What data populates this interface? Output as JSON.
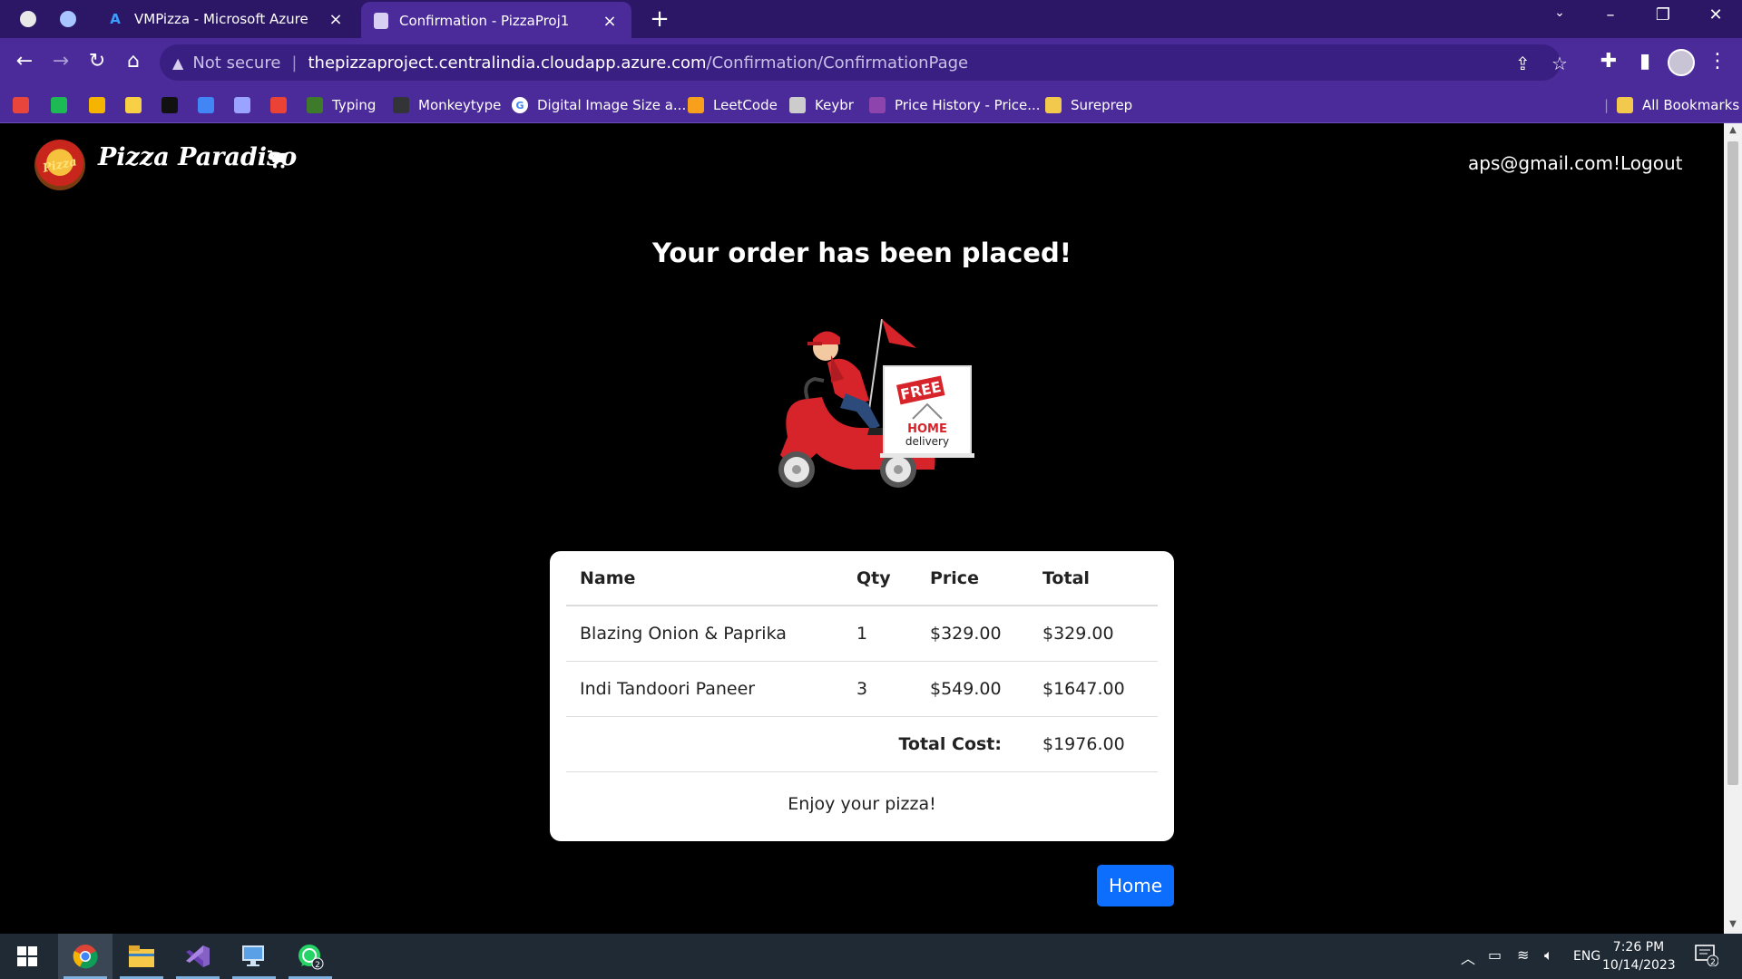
{
  "browser": {
    "tabs": [
      {
        "title": "VMPizza - Microsoft Azure",
        "icon": "azure-icon",
        "active": false
      },
      {
        "title": "Confirmation - PizzaProj1",
        "icon": "page-icon",
        "active": true
      }
    ],
    "omnibox": {
      "security_label": "Not secure",
      "host": "thepizzaproject.centralindia.cloudapp.azure.com",
      "path": "/Confirmation/ConfirmationPage"
    },
    "bookmarks": [
      {
        "label": "",
        "icon": "speedometer-icon",
        "color": "#e8453c"
      },
      {
        "label": "",
        "icon": "spotify-icon",
        "color": "#1db954"
      },
      {
        "label": "",
        "icon": "store-icon",
        "color": "#f4b400"
      },
      {
        "label": "",
        "icon": "flipkart-icon",
        "color": "#f7d046"
      },
      {
        "label": "",
        "icon": "amazon-icon",
        "color": "#111111"
      },
      {
        "label": "",
        "icon": "google-forms-icon",
        "color": "#4285f4"
      },
      {
        "label": "",
        "icon": "gem-icon",
        "color": "#9aa3ff"
      },
      {
        "label": "",
        "icon": "gmail-icon",
        "color": "#ea4335"
      },
      {
        "label": "Typing",
        "icon": "typing-icon",
        "color": "#3d7a2a"
      },
      {
        "label": "Monkeytype",
        "icon": "monkeytype-icon",
        "color": "#323437"
      },
      {
        "label": "Digital Image Size a...",
        "icon": "google-icon",
        "color": "#ffffff"
      },
      {
        "label": "LeetCode",
        "icon": "leetcode-icon",
        "color": "#f89f1b"
      },
      {
        "label": "Keybr",
        "icon": "keyboard-icon",
        "color": "#cccccc"
      },
      {
        "label": "Price History - Price...",
        "icon": "price-history-icon",
        "color": "#8e44ad"
      },
      {
        "label": "Sureprep",
        "icon": "folder-icon",
        "color": "#f2c94c"
      }
    ],
    "all_bookmarks_label": "All Bookmarks"
  },
  "site": {
    "brand": "Pizza Paradiso",
    "logo_text": "Pizza",
    "user_email": "aps@gmail.com!",
    "logout_label": "Logout"
  },
  "confirmation": {
    "heading": "Your order has been placed!",
    "illustration": {
      "sign_free": "FREE",
      "sign_home": "HOME",
      "sign_delivery": "delivery"
    },
    "table": {
      "headers": {
        "name": "Name",
        "qty": "Qty",
        "price": "Price",
        "total": "Total"
      },
      "rows": [
        {
          "name": "Blazing Onion & Paprika",
          "qty": "1",
          "price": "$329.00",
          "total": "$329.00"
        },
        {
          "name": "Indi Tandoori Paneer",
          "qty": "3",
          "price": "$549.00",
          "total": "$1647.00"
        }
      ],
      "total_label": "Total Cost:",
      "total_value": "$1976.00"
    },
    "footer_message": "Enjoy your pizza!",
    "home_button": "Home"
  },
  "taskbar": {
    "apps": [
      {
        "icon": "windows-start-icon"
      },
      {
        "icon": "chrome-icon",
        "active": true
      },
      {
        "icon": "file-explorer-icon"
      },
      {
        "icon": "visual-studio-icon"
      },
      {
        "icon": "remote-desktop-icon"
      },
      {
        "icon": "whatsapp-icon",
        "badge": "2"
      }
    ],
    "language": "ENG",
    "time": "7:26 PM",
    "date": "10/14/2023",
    "notification_count": "2"
  },
  "colors": {
    "tabbar": "#2b1766",
    "toolbar": "#4b2a9a",
    "page_background": "#000000",
    "primary_button": "#0d6efd"
  }
}
